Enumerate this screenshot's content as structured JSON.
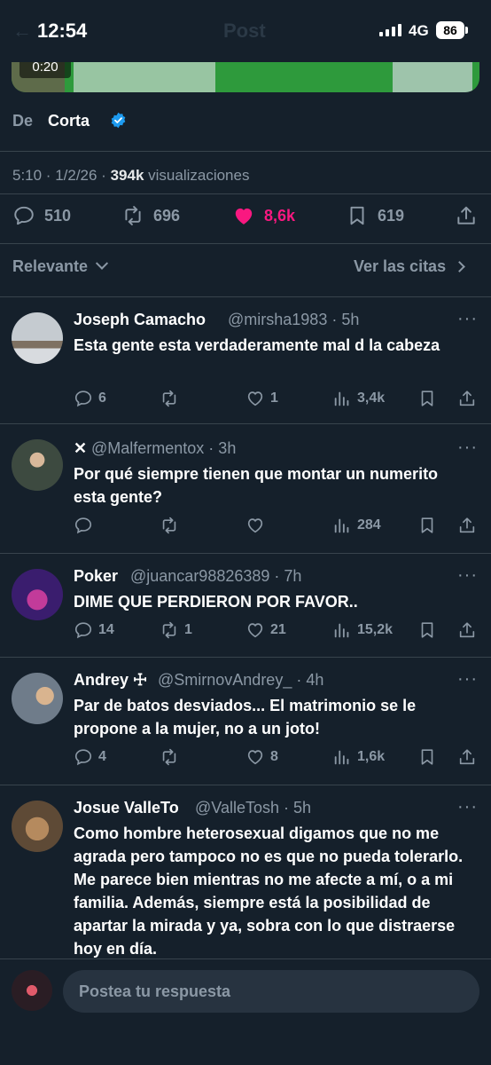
{
  "status_bar": {
    "time": "12:54",
    "network": "4G",
    "battery": "86",
    "faded_title": "Post"
  },
  "video": {
    "time": "0:20"
  },
  "post": {
    "from_label": "De",
    "from_name": "Corta",
    "meta_time": "5:10 · 1/2/26 · ",
    "meta_views": "394k",
    "meta_views_label": " visualizaciones",
    "stats": {
      "replies": "510",
      "reposts": "696",
      "likes": "8,6k",
      "bookmarks": "619"
    },
    "liked_color": "#f91880"
  },
  "sort": {
    "label": "Relevante",
    "quotes_label": "Ver las citas"
  },
  "replies": [
    {
      "name": "Joseph Camacho",
      "handle": "@mirsha1983 · 5h",
      "text": "Esta gente  esta verdaderamente mal d la cabeza",
      "replies": "6",
      "reposts": "",
      "likes": "1",
      "views": "3,4k"
    },
    {
      "name": "✕",
      "handle": "@Malfermentox · 3h",
      "text": "Por qué siempre tienen que montar un numerito esta gente?",
      "replies": "",
      "reposts": "",
      "likes": "",
      "views": "284"
    },
    {
      "name": "Poker",
      "handle": "@juancar98826389 · 7h",
      "text": "DIME QUE PERDIERON POR FAVOR..",
      "replies": "14",
      "reposts": "1",
      "likes": "21",
      "views": "15,2k"
    },
    {
      "name": "Andrey ☩",
      "handle": "@SmirnovAndrey_ · 4h",
      "text": "Par de batos desviados... El matrimonio se le propone a la mujer, no a un joto!",
      "replies": "4",
      "reposts": "",
      "likes": "8",
      "views": "1,6k"
    },
    {
      "name": "Josue ValleTo",
      "handle": "@ValleTosh · 5h",
      "text": "Como hombre heterosexual digamos que no me agrada pero tampoco no es que no pueda tolerarlo. Me parece bien mientras no me afecte a mí, o a mi familia. Además, siempre está la posibilidad de apartar la mirada y ya, sobra con lo que distraerse hoy en día.",
      "replies": "",
      "reposts": "",
      "likes": "",
      "views": ""
    }
  ],
  "composer": {
    "placeholder": "Postea tu respuesta"
  },
  "icons": [
    "chevron-left-icon",
    "signal-icon",
    "battery-icon",
    "verified-icon",
    "reply-icon",
    "repost-icon",
    "like-icon",
    "bookmark-icon",
    "share-icon",
    "chevron-down-icon",
    "chevron-right-icon",
    "more-icon",
    "views-icon"
  ]
}
